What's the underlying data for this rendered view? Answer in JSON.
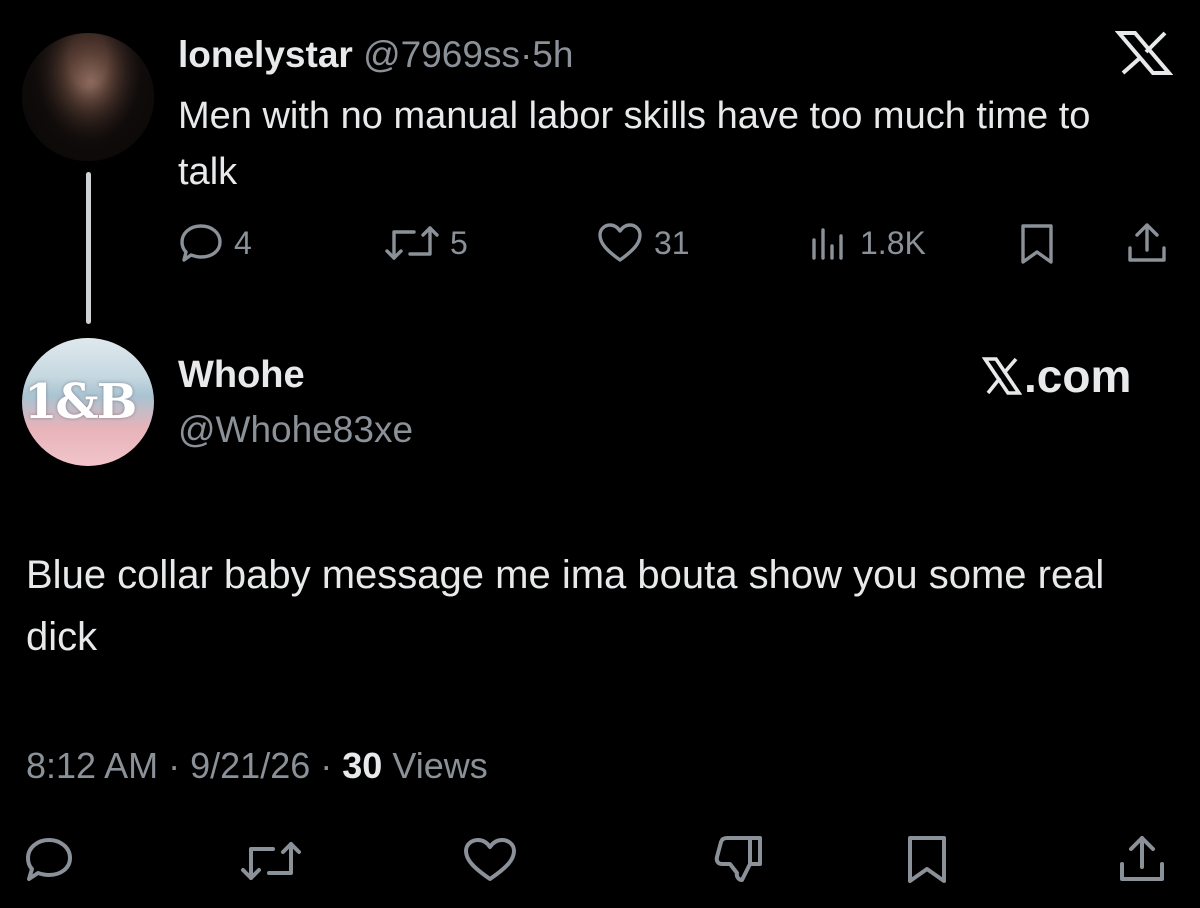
{
  "parent_tweet": {
    "display_name": "lonelystar",
    "handle": "@7969ss",
    "separator": "·",
    "age": "5h",
    "text": "Men with no manual labor skills have too much time to talk",
    "actions": {
      "replies": "4",
      "reposts": "5",
      "likes": "31",
      "views": "1.8K"
    }
  },
  "reply_tweet": {
    "display_name": "Whohe",
    "handle": "@Whohe83xe",
    "avatar_text": "1&B",
    "text": "Blue collar baby message me ima bouta show you some real dick",
    "time": "8:12 AM",
    "date": "9/21/26",
    "separator": "·",
    "views_count": "30",
    "views_label": "Views"
  },
  "branding": {
    "watermark": ".com"
  },
  "icons": {
    "x_logo": "x-logo-icon",
    "reply": "speech-bubble-icon",
    "repost": "repost-arrows-icon",
    "like": "heart-icon",
    "views": "bar-chart-icon",
    "bookmark": "bookmark-icon",
    "share": "share-icon",
    "dislike": "thumbs-down-icon"
  },
  "colors": {
    "background": "#000000",
    "text": "#e7e9ea",
    "muted": "#8b9198",
    "thread_line": "#cfd2d4"
  }
}
